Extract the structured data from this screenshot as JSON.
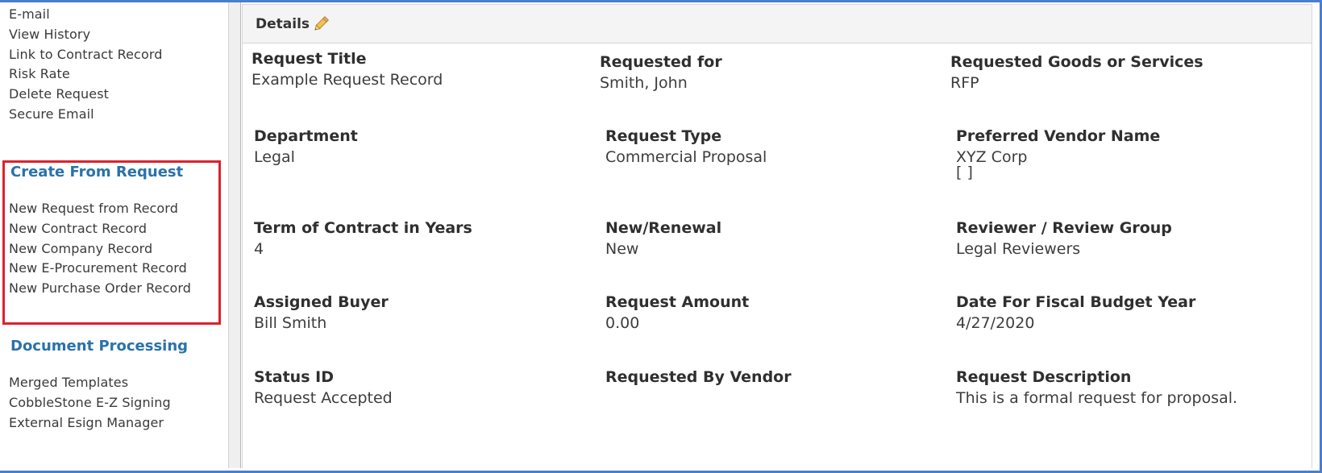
{
  "sidebar": {
    "actions": [
      {
        "label": "E-mail"
      },
      {
        "label": "View History"
      },
      {
        "label": "Link to Contract Record"
      },
      {
        "label": "Risk Rate"
      },
      {
        "label": "Delete Request"
      },
      {
        "label": "Secure Email"
      }
    ],
    "create_from_request": {
      "heading": "Create From Request",
      "items": [
        {
          "label": "New Request from Record"
        },
        {
          "label": "New Contract Record"
        },
        {
          "label": "New Company Record"
        },
        {
          "label": "New E-Procurement Record"
        },
        {
          "label": "New Purchase Order Record"
        }
      ]
    },
    "document_processing": {
      "heading": "Document Processing",
      "items": [
        {
          "label": "Merged Templates"
        },
        {
          "label": "CobbleStone E-Z Signing"
        },
        {
          "label": "External Esign Manager"
        }
      ]
    }
  },
  "details": {
    "title": "Details",
    "edit_icon": "pencil-icon",
    "fields": [
      {
        "label": "Request Title",
        "value": "Example Request Record"
      },
      {
        "label": "Requested for",
        "value": "Smith, John"
      },
      {
        "label": "Requested Goods or Services",
        "value": "RFP"
      },
      {
        "label": "Department",
        "value": "Legal"
      },
      {
        "label": "Request Type",
        "value": "Commercial Proposal"
      },
      {
        "label": "Preferred Vendor Name",
        "value": "XYZ Corp",
        "value2": "[ ]"
      },
      {
        "label": "Term of Contract in Years",
        "value": "4"
      },
      {
        "label": "New/Renewal",
        "value": "New"
      },
      {
        "label": "Reviewer / Review Group",
        "value": "Legal Reviewers"
      },
      {
        "label": "Assigned Buyer",
        "value": "Bill Smith"
      },
      {
        "label": "Request Amount",
        "value": "0.00"
      },
      {
        "label": "Date For Fiscal Budget Year",
        "value": "4/27/2020"
      },
      {
        "label": "Status ID",
        "value": "Request Accepted"
      },
      {
        "label": "Requested By Vendor",
        "value": ""
      },
      {
        "label": "Request Description",
        "value": "This is a formal request for proposal."
      }
    ]
  },
  "colors": {
    "frame_border": "#4a7fcb",
    "heading_blue": "#2a72a8",
    "highlight_red": "#d9232e"
  }
}
